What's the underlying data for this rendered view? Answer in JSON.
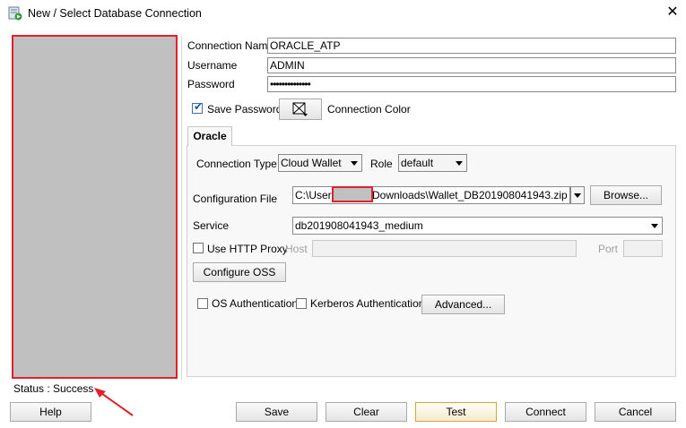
{
  "window": {
    "title": "New / Select Database Connection",
    "close_glyph": "✕",
    "app_icon": "sql-developer-icon"
  },
  "form": {
    "connection_name_label": "Connection Name",
    "connection_name_value": "ORACLE_ATP",
    "username_label": "Username",
    "username_value": "ADMIN",
    "password_label": "Password",
    "password_value": "••••••••••••••",
    "save_password_label": "Save Password",
    "save_password_checked": true,
    "connection_color_label": "Connection Color"
  },
  "tabs": [
    {
      "label": "Oracle",
      "active": true
    }
  ],
  "oracle": {
    "connection_type_label": "Connection Type",
    "connection_type_value": "Cloud Wallet",
    "role_label": "Role",
    "role_value": "default",
    "config_file_label": "Configuration File",
    "config_file_prefix": "C:\\Users",
    "config_file_suffix": "Downloads\\Wallet_DB201908041943.zip",
    "browse_label": "Browse...",
    "service_label": "Service",
    "service_value": "db201908041943_medium",
    "use_http_proxy_label": "Use HTTP Proxy",
    "host_label": "Host",
    "port_label": "Port",
    "configure_oss_label": "Configure OSS",
    "os_auth_label": "OS Authentication",
    "kerberos_auth_label": "Kerberos Authentication",
    "advanced_label": "Advanced..."
  },
  "status": {
    "text": "Status : Success"
  },
  "buttons": {
    "help": "Help",
    "save": "Save",
    "clear": "Clear",
    "test": "Test",
    "connect": "Connect",
    "cancel": "Cancel"
  },
  "colors": {
    "annotation_red": "#e0202a",
    "redacted_gray": "#c0c0c0"
  }
}
